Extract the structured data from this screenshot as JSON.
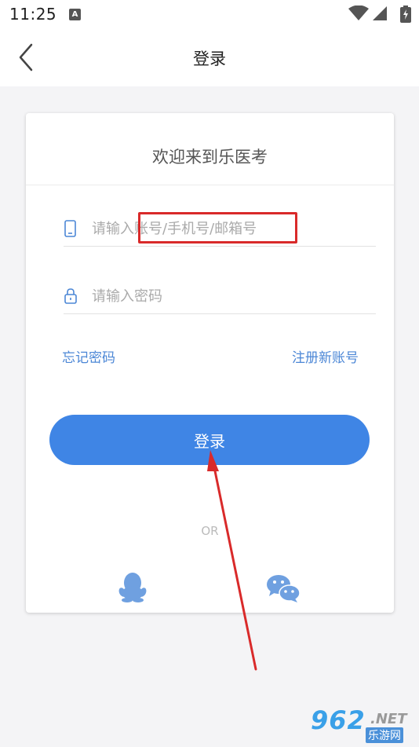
{
  "status_bar": {
    "time": "11:25",
    "notification_icon": "A"
  },
  "nav": {
    "back_icon": "chevron-left-icon",
    "title": "登录"
  },
  "card": {
    "welcome": "欢迎来到乐医考",
    "account_input": {
      "placeholder": "请输入账号/手机号/邮箱号",
      "value": "",
      "icon": "phone-icon"
    },
    "password_input": {
      "placeholder": "请输入密码",
      "value": "",
      "icon": "lock-icon"
    },
    "forgot_password": "忘记密码",
    "register": "注册新账号",
    "login_button": "登录",
    "or_label": "OR",
    "social": {
      "qq_icon": "qq-icon",
      "wechat_icon": "wechat-icon"
    }
  },
  "colors": {
    "accent": "#3f85e5",
    "link": "#4c87d6",
    "annotation": "#d92a2a"
  },
  "watermark": {
    "number": "962",
    "suffix": ".NET",
    "sub": "乐游网"
  }
}
